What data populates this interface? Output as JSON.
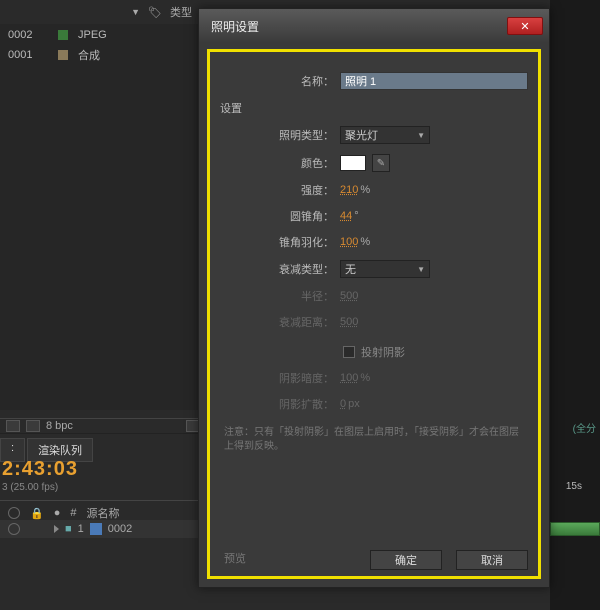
{
  "project": {
    "type_header": "类型",
    "rows": [
      {
        "name": "0002",
        "type": "JPEG"
      },
      {
        "name": "0001",
        "type": "合成"
      }
    ]
  },
  "footer": {
    "bpc": "8 bpc"
  },
  "tabs": {
    "render_queue": "渲染队列"
  },
  "timecode": {
    "value": "2:43:03",
    "sub": "3 (25.00 fps)"
  },
  "timeline": {
    "col_num": "#",
    "col_source": "源名称",
    "row_index": "1",
    "row_name": "0002"
  },
  "right": {
    "label": "(全分",
    "marker": "15s"
  },
  "dialog": {
    "title": "照明设置",
    "name_label": "名称：",
    "name_value": "照明 1",
    "section": "设置",
    "light_type_label": "照明类型：",
    "light_type_value": "聚光灯",
    "color_label": "颜色：",
    "intensity_label": "强度：",
    "intensity_value": "210",
    "intensity_unit": "%",
    "cone_angle_label": "圆锥角：",
    "cone_angle_value": "44",
    "cone_angle_unit": "°",
    "cone_feather_label": "锥角羽化：",
    "cone_feather_value": "100",
    "cone_feather_unit": "%",
    "falloff_type_label": "衰减类型：",
    "falloff_type_value": "无",
    "radius_label": "半径：",
    "radius_value": "500",
    "falloff_dist_label": "衰减距离：",
    "falloff_dist_value": "500",
    "cast_shadow": "投射阴影",
    "shadow_darkness_label": "阴影暗度：",
    "shadow_darkness_value": "100",
    "shadow_darkness_unit": "%",
    "shadow_diffusion_label": "阴影扩散：",
    "shadow_diffusion_value": "0",
    "shadow_diffusion_unit": "px",
    "note": "注意：只有「投射阴影」在图层上启用时，「接受阴影」才会在图层上得到反映。",
    "preview": "预览",
    "ok": "确定",
    "cancel": "取消"
  }
}
